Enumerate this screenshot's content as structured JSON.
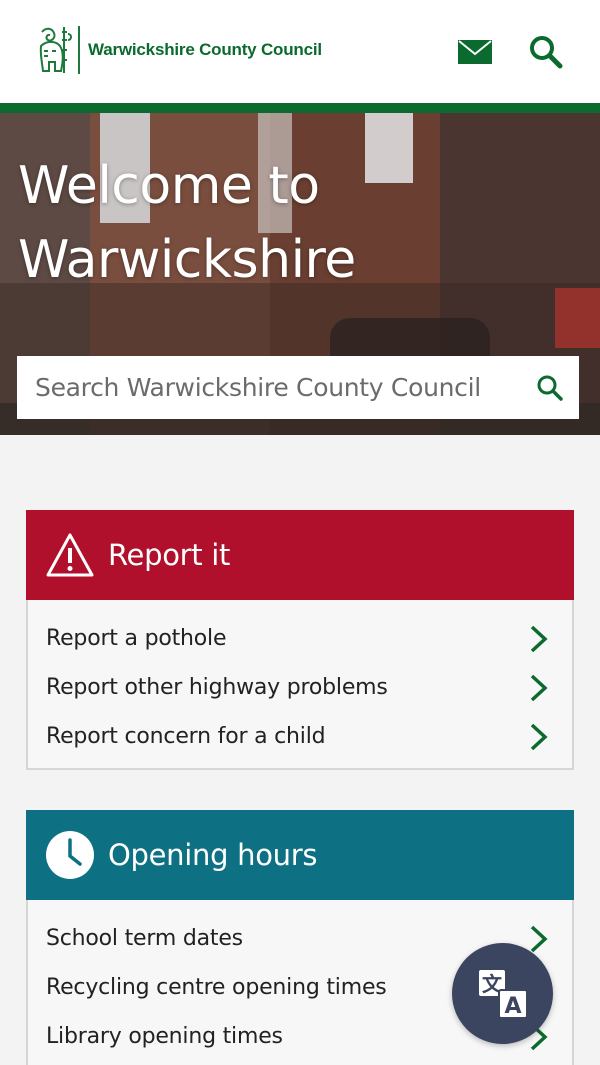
{
  "header": {
    "council_name": "Warwickshire County Council",
    "mail_icon": "envelope-icon",
    "search_icon": "search-icon"
  },
  "hero": {
    "title": "Welcome to Warwickshire",
    "search_placeholder": "Search Warwickshire County Council"
  },
  "report": {
    "title": "Report it",
    "icon": "warning-triangle-icon",
    "items": [
      {
        "label": "Report a pothole"
      },
      {
        "label": "Report other highway problems"
      },
      {
        "label": "Report concern for a child"
      }
    ]
  },
  "opening": {
    "title": "Opening hours",
    "icon": "clock-icon",
    "items": [
      {
        "label": "School term dates"
      },
      {
        "label": "Recycling centre opening times"
      },
      {
        "label": "Library opening times"
      }
    ]
  },
  "translate": {
    "icon": "translate-icon"
  },
  "colors": {
    "brand_green": "#0b6b2f",
    "report_red": "#b0102c",
    "hours_teal": "#0e7083",
    "translate_bg": "#3b4560"
  }
}
